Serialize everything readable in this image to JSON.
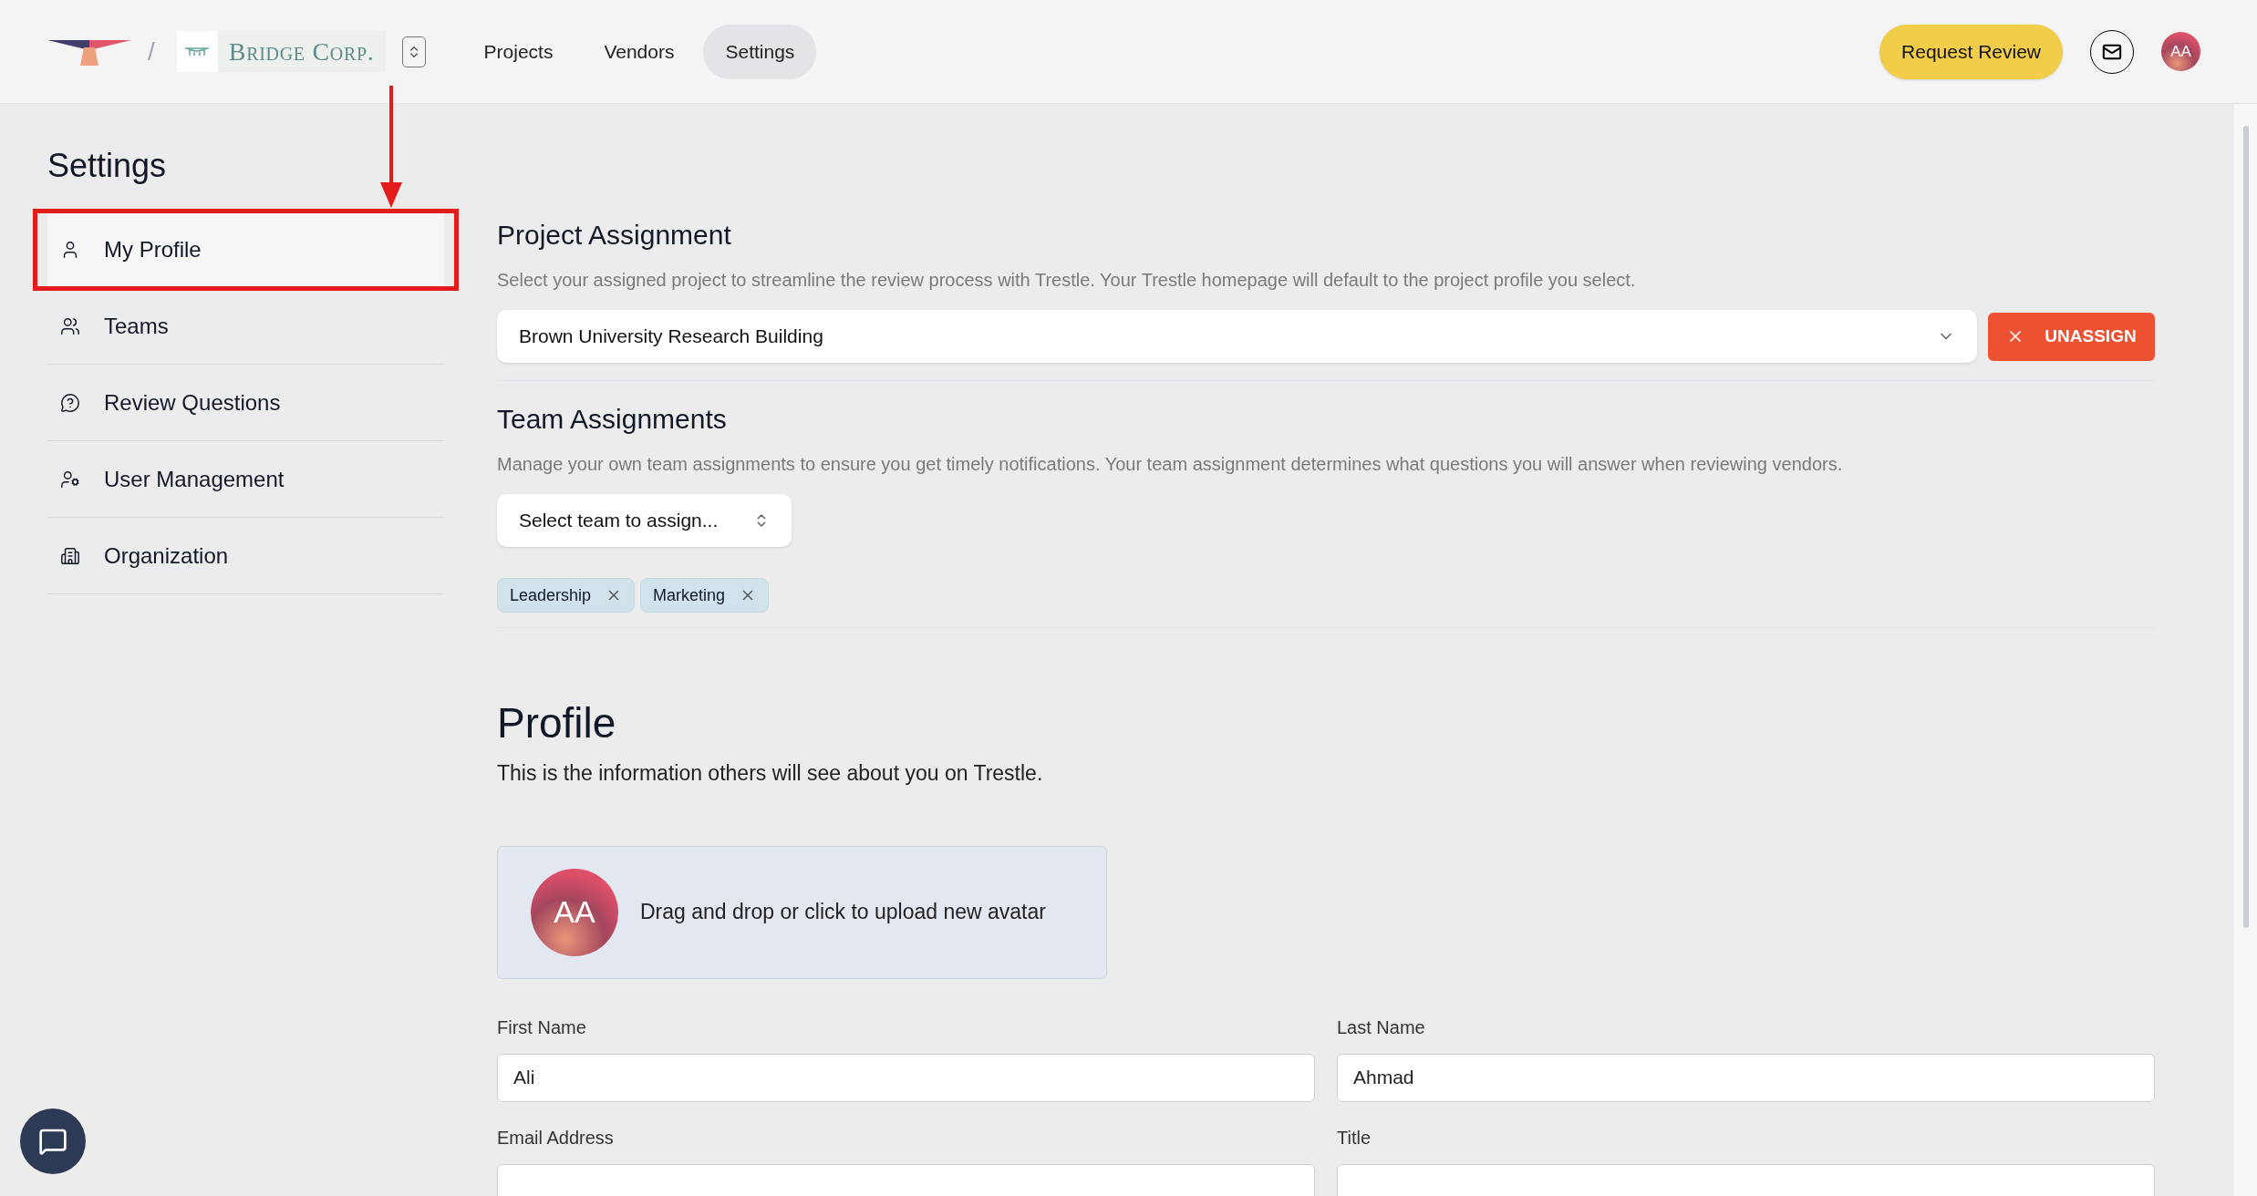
{
  "header": {
    "separator": "/",
    "brand": "Bridge Corp.",
    "nav": [
      {
        "label": "Projects",
        "selected": false
      },
      {
        "label": "Vendors",
        "selected": false
      },
      {
        "label": "Settings",
        "selected": true
      }
    ],
    "request_button": "Request Review",
    "user_initials": "AA"
  },
  "sidebar": {
    "title": "Settings",
    "items": [
      {
        "label": "My Profile",
        "selected": true,
        "highlighted": true
      },
      {
        "label": "Teams",
        "selected": false,
        "highlighted": false
      },
      {
        "label": "Review Questions",
        "selected": false,
        "highlighted": false
      },
      {
        "label": "User Management",
        "selected": false,
        "highlighted": false
      },
      {
        "label": "Organization",
        "selected": false,
        "highlighted": false
      }
    ]
  },
  "project_assignment": {
    "title": "Project Assignment",
    "description": "Select your assigned project to streamline the review process with Trestle. Your Trestle homepage will default to the project profile you select.",
    "project_select": {
      "value": "Brown University Research Building"
    },
    "unassign_button": "UNASSIGN"
  },
  "team_assignments": {
    "title": "Team Assignments",
    "description": "Manage your own team assignments to ensure you get timely notifications. Your team assignment determines what questions you will answer when reviewing vendors.",
    "team_select": {
      "placeholder": "Select team to assign..."
    },
    "tags": [
      "Leadership",
      "Marketing"
    ]
  },
  "profile": {
    "title": "Profile",
    "description": "This is the information others will see about you on Trestle.",
    "avatar_upload": {
      "initials": "AA",
      "text": "Drag and drop or click to upload new avatar"
    },
    "fields": [
      {
        "label": "First Name",
        "value": "Ali"
      },
      {
        "label": "Last Name",
        "value": "Ahmad"
      },
      {
        "label": "Email Address"
      },
      {
        "label": "Title"
      }
    ]
  }
}
